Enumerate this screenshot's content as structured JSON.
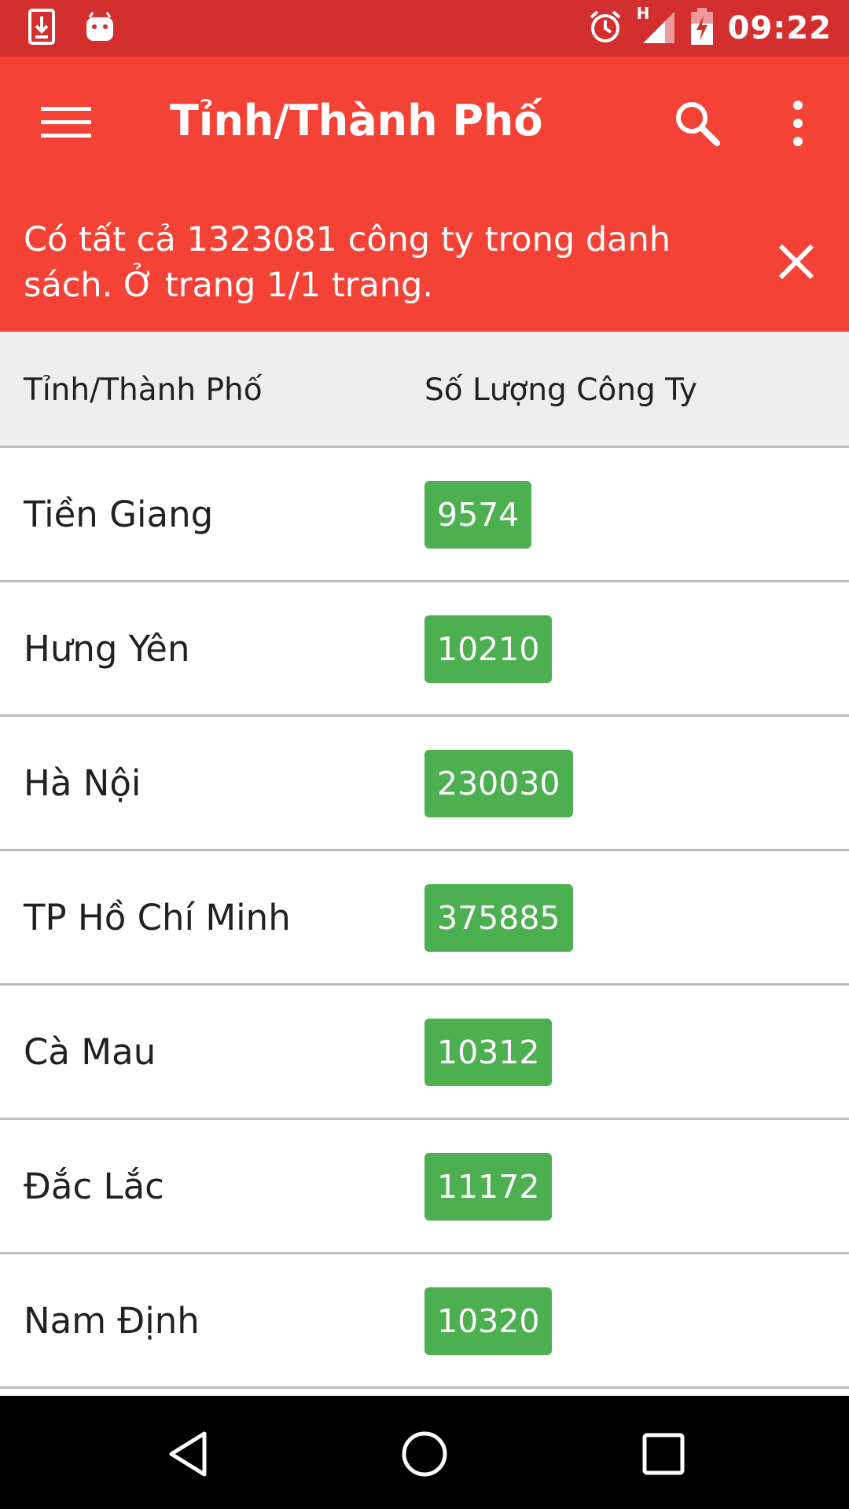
{
  "status_bar": {
    "time": "09:22",
    "left_icons": [
      "download-notification-icon",
      "android-notification-icon"
    ],
    "right_icons": [
      "alarm-icon",
      "signal-h-icon",
      "battery-charging-icon"
    ],
    "network_label": "H",
    "color": "#d32f2f"
  },
  "toolbar": {
    "title": "Tỉnh/Thành Phố",
    "menu_icon": "hamburger-menu-icon",
    "search_icon": "search-icon",
    "more_icon": "more-vert-icon",
    "color": "#f44336"
  },
  "banner": {
    "text": "Có tất cả 1323081 công ty trong danh sách. Ở trang 1/1 trang.",
    "close_icon": "close-icon"
  },
  "table": {
    "headers": [
      "Tỉnh/Thành Phố",
      "Số Lượng Công Ty"
    ],
    "rows": [
      {
        "name": "Tiền Giang",
        "count": "9574"
      },
      {
        "name": "Hưng Yên",
        "count": "10210"
      },
      {
        "name": "Hà Nội",
        "count": "230030"
      },
      {
        "name": "TP Hồ Chí Minh",
        "count": "375885"
      },
      {
        "name": "Cà Mau",
        "count": "10312"
      },
      {
        "name": "Đắc Lắc",
        "count": "11172"
      },
      {
        "name": "Nam Định",
        "count": "10320"
      }
    ],
    "badge_color": "#4caf50"
  },
  "nav_bar": {
    "buttons": [
      "back-icon",
      "home-icon",
      "recents-icon"
    ]
  }
}
